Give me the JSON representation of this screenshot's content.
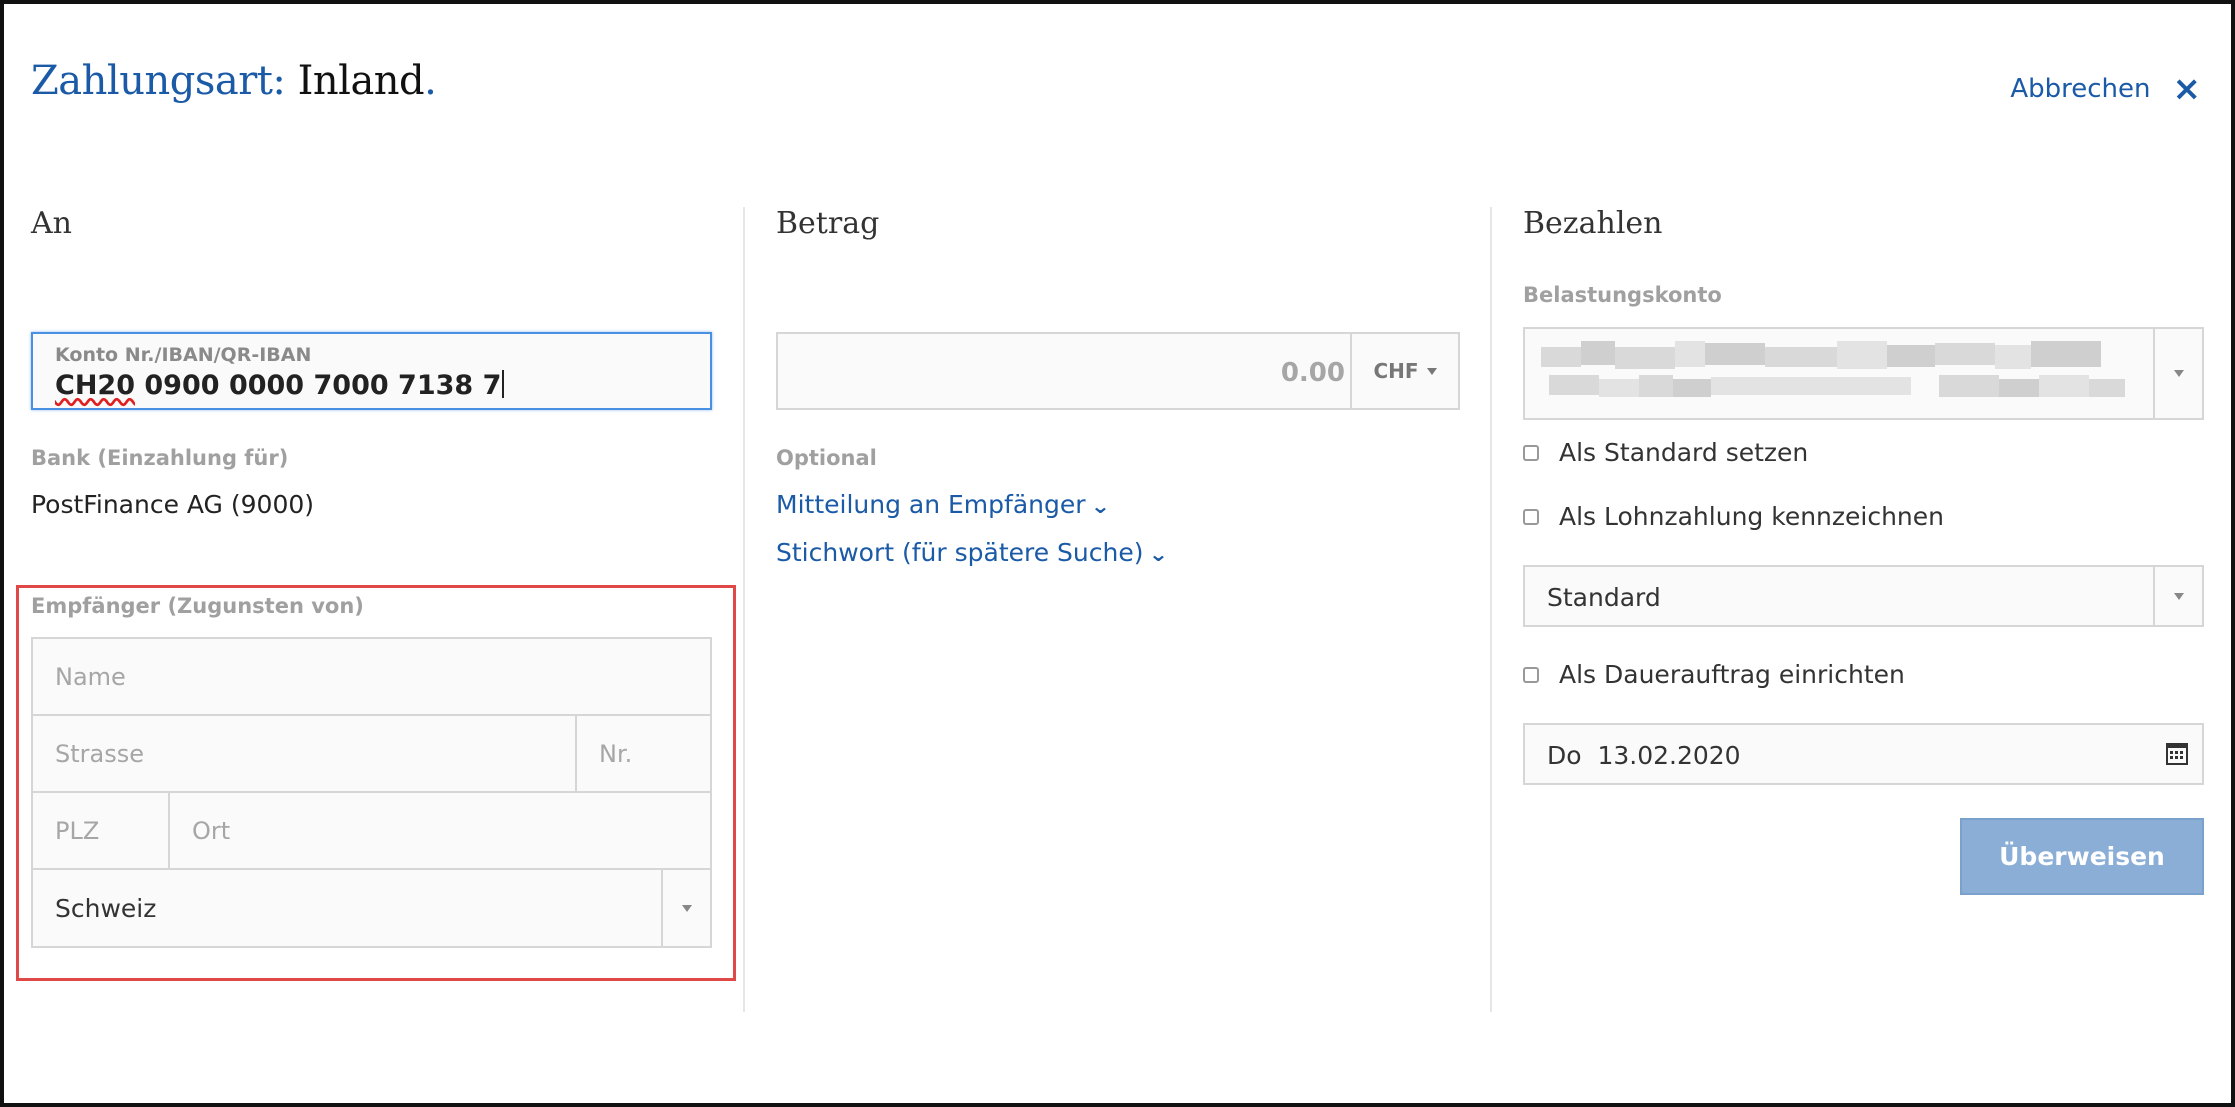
{
  "header": {
    "title_label": "Zahlungsart:",
    "title_value": "Inland",
    "title_dot": ".",
    "cancel_label": "Abbrechen",
    "close_icon": "×"
  },
  "columns": {
    "an": "An",
    "betrag": "Betrag",
    "bezahlen": "Bezahlen"
  },
  "an": {
    "iban_label": "Konto Nr./IBAN/QR-IBAN",
    "iban_value_prefix": "CH20",
    "iban_value_rest": " 0900 0000 7000 7138 7",
    "bank_label": "Bank (Einzahlung für)",
    "bank_value": "PostFinance AG (9000)",
    "recipient_label": "Empfänger (Zugunsten von)",
    "name_placeholder": "Name",
    "street_placeholder": "Strasse",
    "nr_placeholder": "Nr.",
    "plz_placeholder": "PLZ",
    "ort_placeholder": "Ort",
    "country_value": "Schweiz"
  },
  "betrag": {
    "amount_placeholder": "0.00",
    "currency": "CHF",
    "optional_label": "Optional",
    "message_link": "Mitteilung an Empfänger",
    "keyword_link": "Stichwort (für spätere Suche)"
  },
  "bezahlen": {
    "account_label": "Belastungskonto",
    "set_default": "Als Standard setzen",
    "mark_salary": "Als Lohnzahlung kennzeichnen",
    "priority_value": "Standard",
    "standing_order": "Als Dauerauftrag einrichten",
    "date_weekday": "Do",
    "date_value": "13.02.2020",
    "submit_label": "Überweisen"
  },
  "colors": {
    "accent": "#1a5aa6",
    "focus_border": "#4a90e2",
    "highlight_border": "#e04848",
    "button_bg": "#8aaed6"
  },
  "icons": {
    "close": "close-icon",
    "chevron": "chevron-down-icon",
    "calendar": "calendar-icon"
  }
}
